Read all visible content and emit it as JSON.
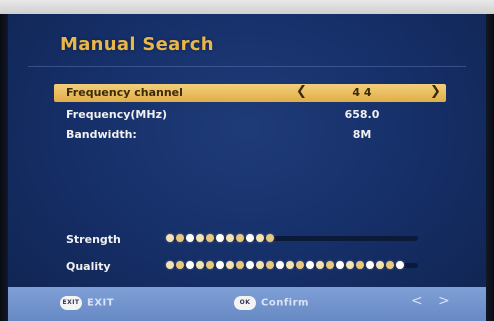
{
  "title": "Manual Search",
  "rows": [
    {
      "label": "Frequency channel",
      "value": "4 4",
      "left_arrow": "❮",
      "right_arrow": "❯"
    },
    {
      "label": "Frequency(MHz)",
      "value": "658.0"
    },
    {
      "label": "Bandwidth:",
      "value": "8M"
    }
  ],
  "meters": [
    {
      "label": "Strength",
      "level": 0.44
    },
    {
      "label": "Quality",
      "level": 0.97
    }
  ],
  "footer": {
    "exit_key": "EXIT",
    "exit_label": "EXIT",
    "ok_key": "OK",
    "confirm_label": "Confirm",
    "prev_symbol": "<",
    "next_symbol": ">"
  },
  "colors": {
    "accent": "#e9b64a",
    "background": "#16306a",
    "dot_colors": [
      "#f3e2b2",
      "#e8c87c",
      "#ffffff"
    ]
  }
}
